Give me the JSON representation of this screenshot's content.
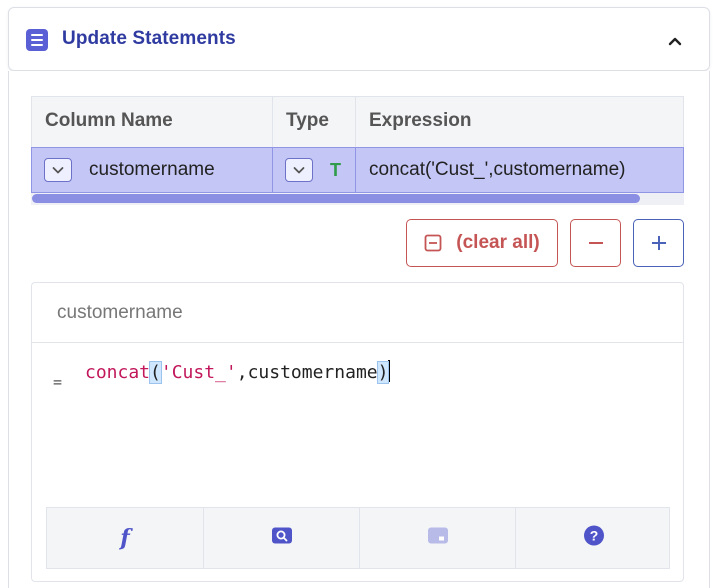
{
  "panel": {
    "title": "Update Statements",
    "icon": "list-doc-icon",
    "collapse_icon": "chevron-up-icon"
  },
  "table": {
    "headers": [
      "Column Name",
      "Type",
      "Expression"
    ],
    "rows": [
      {
        "column_name": "customername",
        "type": "T",
        "expression": "concat('Cust_',customername)"
      }
    ]
  },
  "actions": {
    "clear_all_label": "(clear all)",
    "remove_icon": "minus-icon",
    "add_icon": "plus-icon"
  },
  "editor": {
    "column": "customername",
    "operator": "=",
    "code": {
      "fn": "concat",
      "open": "(",
      "str": "'Cust_'",
      "comma": ",",
      "arg": "customername",
      "close": ")"
    },
    "toolbar": [
      "function-icon",
      "search-icon",
      "field-icon",
      "help-icon"
    ]
  },
  "colors": {
    "accent": "#5a5fd6",
    "selected_row": "#c4c6f5",
    "danger": "#c55555",
    "type_text": "#2e9c4a"
  }
}
